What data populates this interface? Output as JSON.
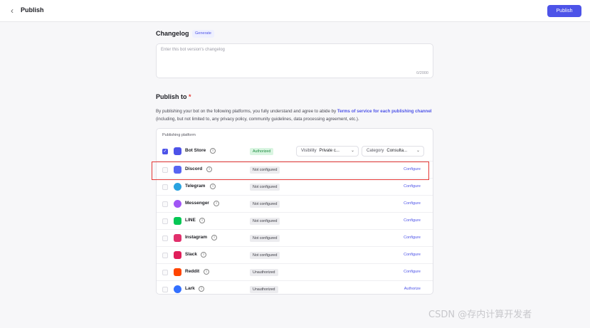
{
  "header": {
    "back_icon": "chevron-left-icon",
    "title": "Publish",
    "publish_label": "Publish"
  },
  "changelog": {
    "title": "Changelog",
    "generate_label": "Generate",
    "placeholder": "Enter this bot version's changelog",
    "counter": "0/2000"
  },
  "publish_to": {
    "title": "Publish to",
    "required_mark": "*",
    "desc_before": "By publishing your bot on the following platforms, you fully understand and agree to abide by ",
    "desc_link": "Terms of service for each publishing channel",
    "desc_after": " (including, but not limited to, any privacy policy, community guidelines, data processing agreement, etc.)."
  },
  "platform_table": {
    "header": "Publishing platform",
    "rows": [
      {
        "name": "Bot Store",
        "status": "Authorized",
        "icon": "bot-store-icon",
        "color": "#4d53e8",
        "checked": true,
        "visibility_label": "Visibility",
        "visibility_value": "Private c...",
        "category_label": "Category",
        "category_value": "Consulta..."
      },
      {
        "name": "Discord",
        "status": "Not configured",
        "action": "Configure",
        "icon": "discord-icon",
        "color": "#5865f2"
      },
      {
        "name": "Telegram",
        "status": "Not configured",
        "action": "Configure",
        "icon": "telegram-icon",
        "color": "#2aa3e0"
      },
      {
        "name": "Messenger",
        "status": "Not configured",
        "action": "Configure",
        "icon": "messenger-icon",
        "color": "#a055f5"
      },
      {
        "name": "LINE",
        "status": "Not configured",
        "action": "Configure",
        "icon": "line-icon",
        "color": "#06c755"
      },
      {
        "name": "Instagram",
        "status": "Not configured",
        "action": "Configure",
        "icon": "instagram-icon",
        "color": "#e1306c"
      },
      {
        "name": "Slack",
        "status": "Not configured",
        "action": "Configure",
        "icon": "slack-icon",
        "color": "#e01e5a"
      },
      {
        "name": "Reddit",
        "status": "Unauthorized",
        "action": "Configure",
        "icon": "reddit-icon",
        "color": "#ff4500"
      },
      {
        "name": "Lark",
        "status": "Unauthorized",
        "action": "Authorize",
        "icon": "lark-icon",
        "color": "#3370ff"
      }
    ]
  },
  "watermark": "CSDN @存内计算开发者"
}
